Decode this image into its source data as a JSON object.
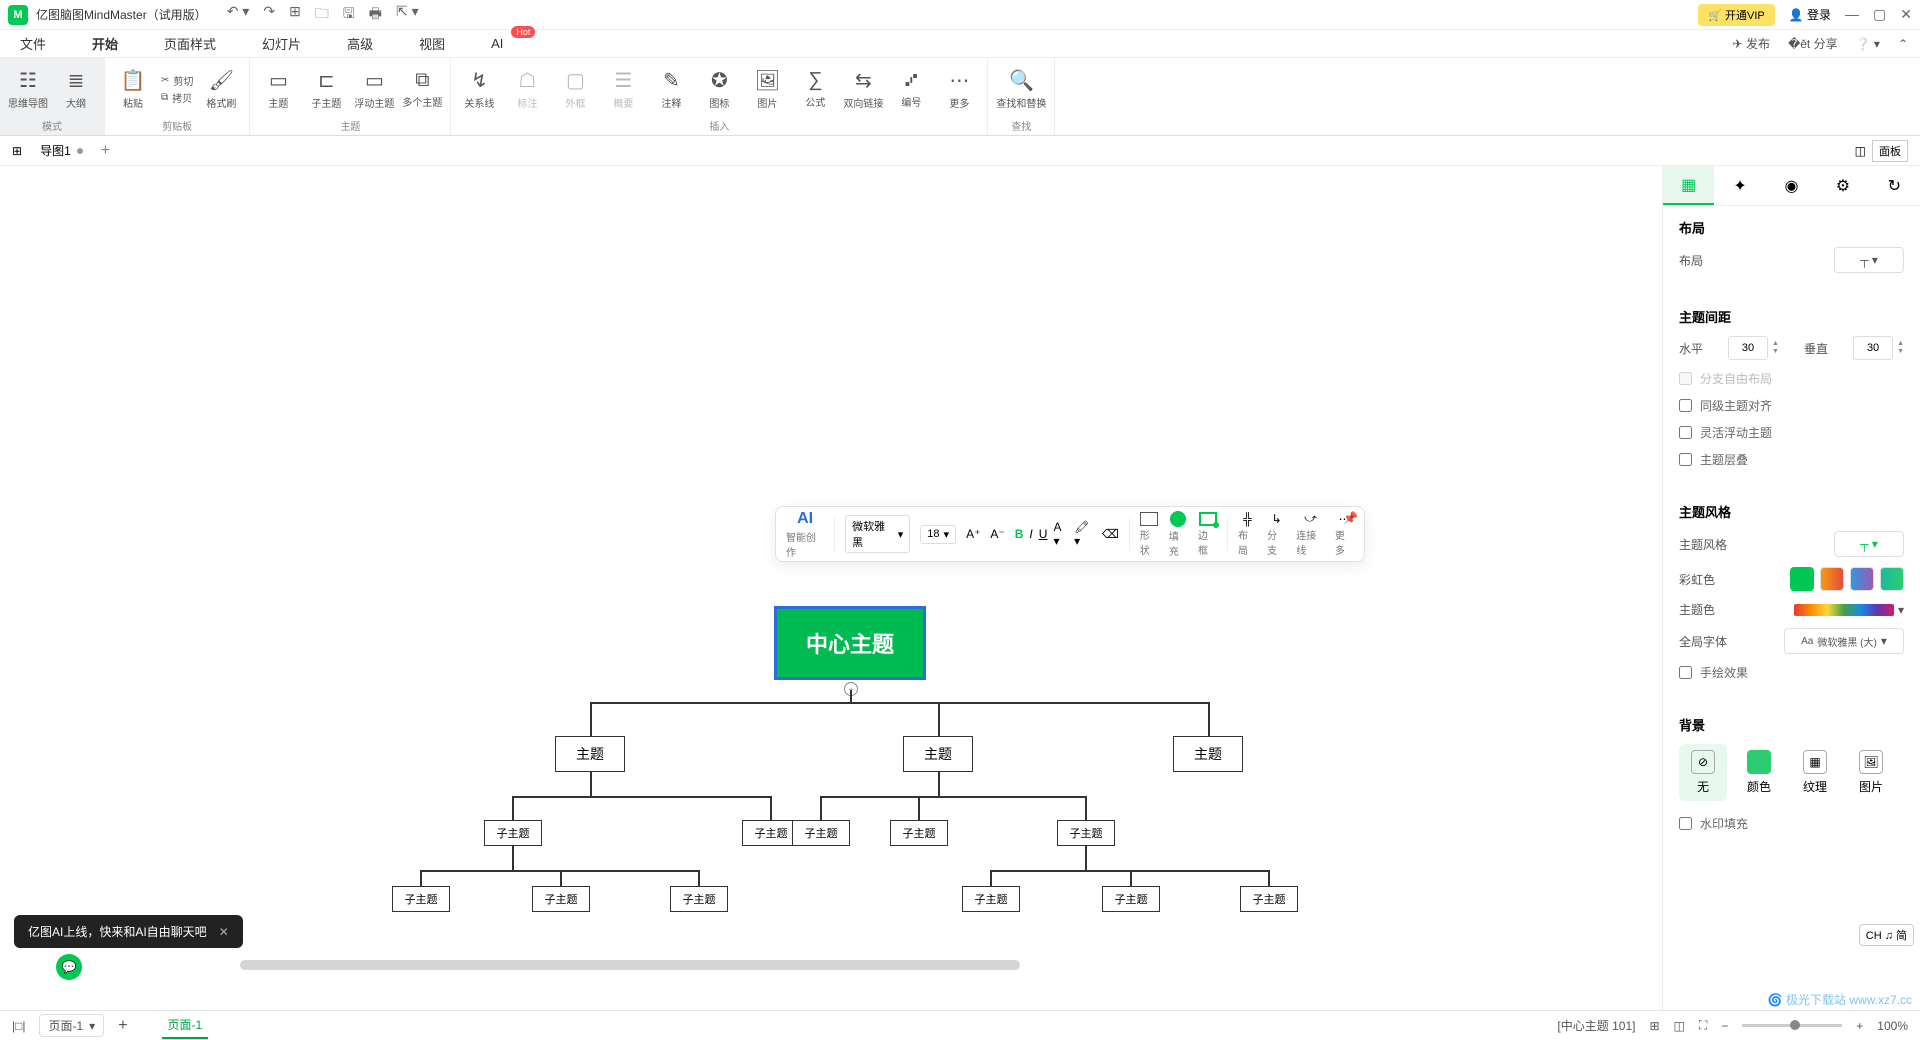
{
  "app": {
    "title": "亿图脑图MindMaster（试用版）"
  },
  "titlebar": {
    "vip": "开通VIP",
    "login": "登录"
  },
  "menu": {
    "tabs": [
      "文件",
      "开始",
      "页面样式",
      "幻灯片",
      "高级",
      "视图",
      "AI"
    ],
    "active": 1,
    "hot": "Hot",
    "publish": "发布",
    "share": "分享"
  },
  "ribbon": {
    "groups": {
      "mode": {
        "label": "模式",
        "mindmap": "思维导图",
        "outline": "大纲"
      },
      "clipboard": {
        "label": "剪贴板",
        "paste": "粘贴",
        "cut": "剪切",
        "copy": "拷贝",
        "format": "格式刷"
      },
      "topic": {
        "label": "主题",
        "main": "主题",
        "sub": "子主题",
        "float": "浮动主题",
        "multi": "多个主题"
      },
      "insert": {
        "label": "插入",
        "relation": "关系线",
        "annotation": "标注",
        "frame": "外框",
        "summary": "概要",
        "note": "注释",
        "icon": "图标",
        "image": "图片",
        "formula": "公式",
        "link": "双向链接",
        "number": "编号",
        "more": "更多"
      },
      "find": {
        "label": "查找",
        "findreplace": "查找和替换"
      }
    }
  },
  "docTab": {
    "name": "导图1",
    "panel": "面板"
  },
  "floatTb": {
    "ai": "AI",
    "ai_label": "智能创作",
    "font": "微软雅黑",
    "size": "18",
    "shape": "形状",
    "fill": "填充",
    "border": "边框",
    "layout": "布局",
    "branch": "分支",
    "connector": "连接线",
    "more": "更多"
  },
  "mindmap": {
    "center": "中心主题",
    "topics": [
      "主题",
      "主题",
      "主题"
    ],
    "subs": [
      "子主题",
      "子主题",
      "子主题",
      "子主题",
      "子主题"
    ],
    "leafs": [
      "子主题",
      "子主题",
      "子主题",
      "子主题",
      "子主题",
      "子主题"
    ]
  },
  "rightPanel": {
    "layout": {
      "title": "布局",
      "label": "布局"
    },
    "spacing": {
      "title": "主题间距",
      "horizontal": "水平",
      "h_val": "30",
      "vertical": "垂直",
      "v_val": "30"
    },
    "checks": {
      "free": "分支自由布局",
      "align": "同级主题对齐",
      "flex": "灵活浮动主题",
      "stack": "主题层叠"
    },
    "style": {
      "title": "主题风格",
      "label": "主题风格",
      "rainbow": "彩虹色",
      "themecolor": "主题色",
      "font": "全局字体",
      "font_val": "微软雅黑 (大)",
      "hand": "手绘效果"
    },
    "bg": {
      "title": "背景",
      "none": "无",
      "color": "颜色",
      "texture": "纹理",
      "image": "图片",
      "watermark": "水印填充"
    }
  },
  "ime": "CH ♫ 简",
  "aiNotice": "亿图AI上线，快来和AI自由聊天吧",
  "status": {
    "page": "页面-1",
    "page_tab": "页面-1",
    "selection": "[中心主题 101]",
    "zoom": "100%"
  },
  "watermark": "极光下载站 www.xz7.cc"
}
